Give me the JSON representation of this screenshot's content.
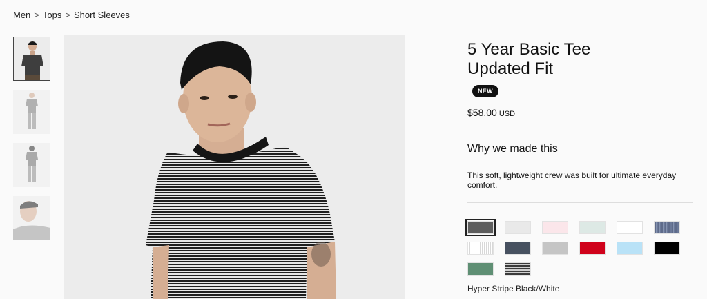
{
  "breadcrumb": {
    "items": [
      "Men",
      "Tops",
      "Short Sleeves"
    ],
    "separator": ">"
  },
  "thumbnails": [
    {
      "name": "front-view"
    },
    {
      "name": "full-body-front"
    },
    {
      "name": "full-body-back"
    },
    {
      "name": "close-up"
    }
  ],
  "product": {
    "title_line1": "5 Year Basic Tee",
    "title_line2": "Updated Fit",
    "badge": "NEW",
    "price": "$58.00",
    "currency": "USD",
    "why_heading": "Why we made this",
    "description": "This soft, lightweight crew was built for ultimate everyday comfort.",
    "selected_color_name": "Hyper Stripe Black/White"
  },
  "swatches": [
    {
      "color": "#5d5d5d",
      "selected": true
    },
    {
      "color": "#e9e9e9"
    },
    {
      "color": "#fbe6ea"
    },
    {
      "color": "#dde9e5"
    },
    {
      "color": "#ffffff"
    },
    {
      "color": "#6a7898",
      "pattern": "heather"
    },
    {
      "color": "#f3f3f3",
      "pattern": "stripe-light"
    },
    {
      "color": "#475160"
    },
    {
      "color": "#c5c5c5"
    },
    {
      "color": "#d0021b"
    },
    {
      "color": "#b9e2f7"
    },
    {
      "color": "#000000"
    },
    {
      "color": "#5f8f74"
    },
    {
      "color": "#555555",
      "pattern": "stripe-dark"
    }
  ]
}
